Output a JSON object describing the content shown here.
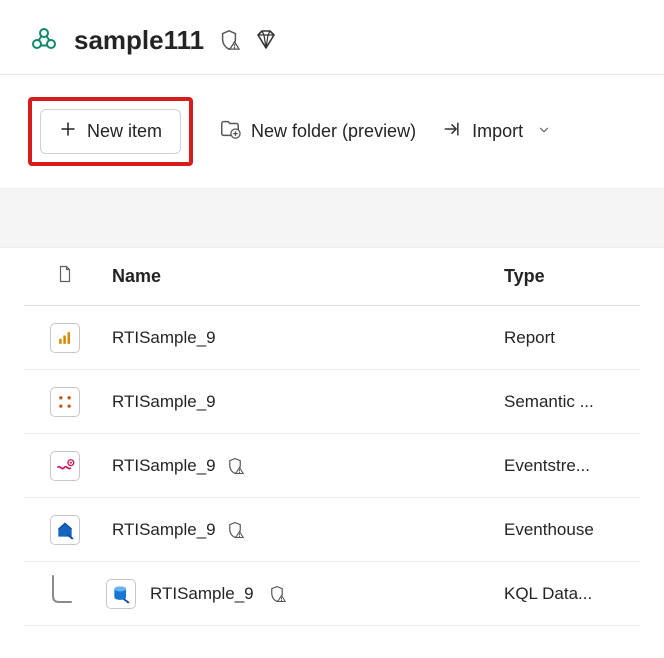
{
  "header": {
    "title": "sample111"
  },
  "toolbar": {
    "new_item_label": "New item",
    "new_folder_label": "New folder (preview)",
    "import_label": "Import"
  },
  "columns": {
    "name": "Name",
    "type": "Type"
  },
  "rows": [
    {
      "name": "RTISample_9",
      "type": "Report",
      "icon": "report",
      "shield": false,
      "child": false
    },
    {
      "name": "RTISample_9",
      "type": "Semantic ...",
      "icon": "semantic",
      "shield": false,
      "child": false
    },
    {
      "name": "RTISample_9",
      "type": "Eventstre...",
      "icon": "eventstream",
      "shield": true,
      "child": false
    },
    {
      "name": "RTISample_9",
      "type": "Eventhouse",
      "icon": "eventhouse",
      "shield": true,
      "child": false
    },
    {
      "name": "RTISample_9",
      "type": "KQL Data...",
      "icon": "kql",
      "shield": true,
      "child": true
    }
  ]
}
